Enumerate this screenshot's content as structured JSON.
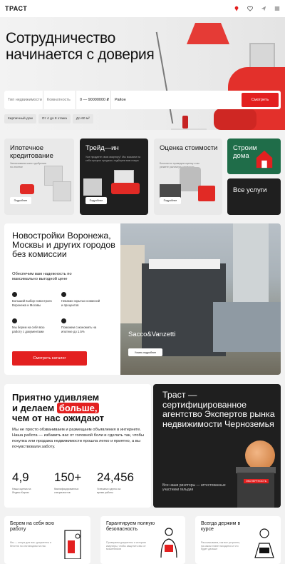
{
  "header": {
    "logo": "ТРАСТ",
    "icons": [
      "location-icon",
      "heart-icon",
      "send-icon",
      "menu-icon"
    ]
  },
  "hero": {
    "title": "Сотрудничество начинается с доверия",
    "search": {
      "type_placeholder": "Тип недвижимости",
      "rooms_placeholder": "Комнатность",
      "price_value": "0 — 90000000 ₽",
      "area_placeholder": "Район",
      "button": "Смотреть"
    },
    "chips": [
      "Кирпичный дом",
      "От 4 до 8 этажа",
      "До 60 м²"
    ]
  },
  "services": [
    {
      "title": "Ипотечное кредитование",
      "desc": "Увеличиваем шанс одобрения по ипотеке",
      "more": "Подробнее"
    },
    {
      "title": "Трейд—ин",
      "desc": "Уже продаете свою квартиру? Мы возьмем на себя процесс продажи, подберем вам новую",
      "more": "Подробнее"
    },
    {
      "title": "Оценка стоимости",
      "desc": "Бесплатно проведем оценку и вы узнаете рыночную стоимость",
      "more": "Подробнее"
    },
    {
      "title": "Строим дома"
    },
    {
      "title": "Все услуги"
    }
  ],
  "catalog": {
    "title": "Новостройки Воронежа, Москвы и других городов без комиссии",
    "subtitle": "Обеспечим вам надежность по максимально выгодной цене",
    "features": [
      "Больший выбор новостроек Воронежа и Москвы",
      "Никаких скрытых комиссий и процентов",
      "Мы берем на себя всю работу с документами",
      "Поможем сэкономить на ипотеке до 1.5%"
    ],
    "button": "Смотреть каталог",
    "photo_label": "Sacco&Vanzetti",
    "photo_more": "Узнать подробнее"
  },
  "about": {
    "title_1": "Приятно удивляем",
    "title_2": "и делаем",
    "title_highlight": "больше,",
    "title_3": "чем от нас ожидают",
    "text": "Мы не просто обзваниваем и размещаем объявления в интернете. Наша работа — избавить вас от головной боли и сделать так, чтобы покупка или продажа недвижимости прошла легко и приятно, а вы почувствовали заботу.",
    "stats": [
      {
        "value": "4,9",
        "label": "Наша оценка на Яндекс.Картах"
      },
      {
        "value": "150+",
        "label": "Квалифицированных специалистов"
      },
      {
        "value": "24,456",
        "label": "Успешных сделок за время работы"
      }
    ]
  },
  "guild": {
    "title": "Траст — сертифицированное агентство Экспертов рынка недвижимости Черноземья",
    "subtitle": "Все наши риэлторы — аттестованные участники гильдии",
    "badge": "ЭКСПЕРТНОСТЬ"
  },
  "bottom": [
    {
      "title": "Берем на себя всю работу",
      "desc": "Мы — опора для вас: документы и беготня по инстанциям на нас"
    },
    {
      "title": "Гарантируем полную безопасность",
      "desc": "Проверяем документы и историю квартиры, чтобы защитить вас от мошенников"
    },
    {
      "title": "Всегда держим в курсе",
      "desc": "Рассказываем, как все устроено, на каком этапе находится и что будет дальше"
    }
  ],
  "colors": {
    "accent": "#e32020",
    "dark": "#1f1f1f",
    "green": "#1f6d49"
  }
}
